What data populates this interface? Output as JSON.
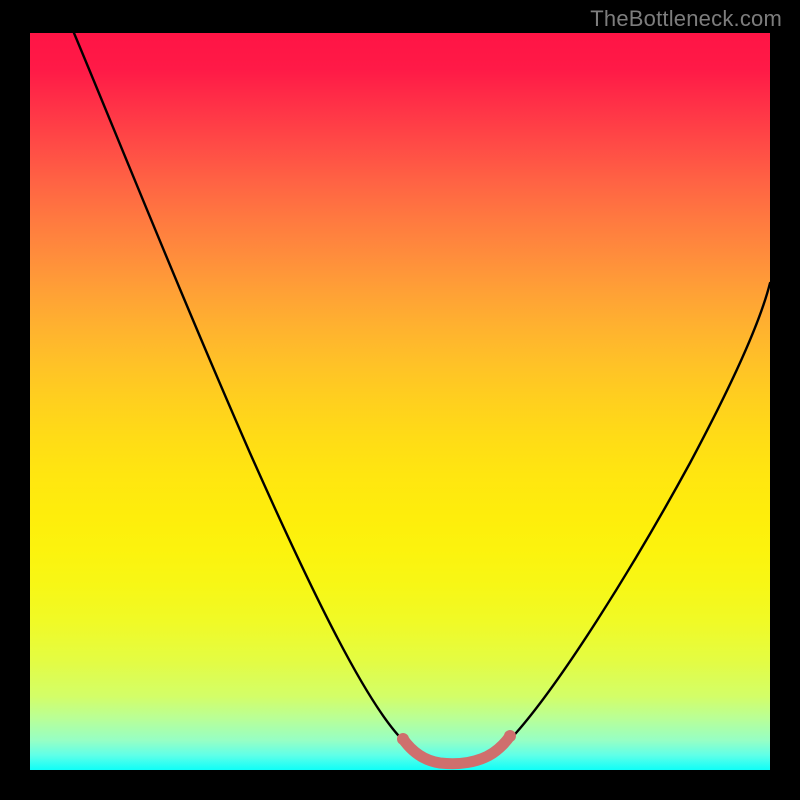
{
  "watermark": "TheBottleneck.com",
  "chart_data": {
    "type": "line",
    "title": "",
    "xlabel": "",
    "ylabel": "",
    "xlim": [
      0,
      100
    ],
    "ylim": [
      0,
      100
    ],
    "grid": false,
    "series": [
      {
        "name": "curve",
        "color": "#000000",
        "x": [
          6,
          10,
          15,
          20,
          25,
          30,
          35,
          40,
          45,
          49,
          52,
          54,
          56,
          58,
          60,
          62,
          65,
          70,
          75,
          80,
          85,
          90,
          95,
          100
        ],
        "y": [
          100,
          92,
          82,
          72,
          62,
          52,
          42,
          32,
          21,
          11,
          5,
          3,
          2,
          2,
          3,
          5,
          10,
          19,
          29,
          38,
          47,
          55,
          62,
          68
        ]
      },
      {
        "name": "highlight",
        "color": "#cf6f6d",
        "x": [
          51,
          53,
          55,
          57,
          59,
          61,
          63
        ],
        "y": [
          5,
          3,
          2,
          2,
          2,
          3,
          5
        ]
      }
    ],
    "background_gradient": {
      "top": "#ff1445",
      "mid": "#ffd01e",
      "bottom": "#10fef7"
    }
  }
}
